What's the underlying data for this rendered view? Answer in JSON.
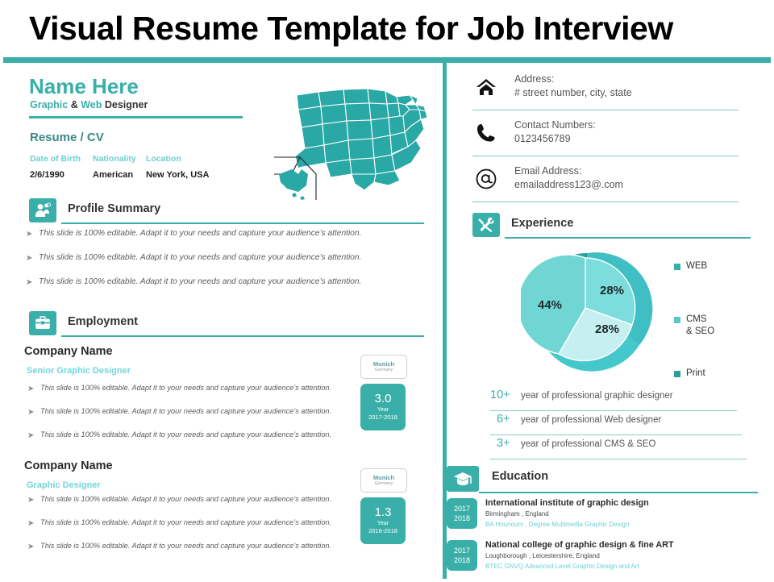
{
  "slide": {
    "title": "Visual Resume Template for Job Interview",
    "accent_color": "#3aafa9",
    "accent_light": "#6ccfcf",
    "accent_pale": "#c5eff0"
  },
  "profile": {
    "name": "Name Here",
    "subtitle_graphic": "Graphic",
    "subtitle_amp": " & ",
    "subtitle_web": "Web",
    "subtitle_designer": " Designer",
    "resume_label": "Resume / CV",
    "meta_headers": [
      "Date of Birth",
      "Nationality",
      "Location"
    ],
    "meta_values": [
      "2/6/1990",
      "American",
      "New York, USA"
    ],
    "map_icon": "usa-map"
  },
  "profile_summary": {
    "icon": "people-icon",
    "title": "Profile Summary",
    "bullets": [
      "This slide is 100% editable. Adapt it to your needs and capture your audience’s attention.",
      "This slide is 100% editable. Adapt it to your needs and capture your audience’s attention.",
      "This slide is 100% editable. Adapt it to your needs and capture your audience’s attention."
    ]
  },
  "employment": {
    "icon": "briefcase-icon",
    "title": "Employment",
    "jobs": [
      {
        "company": "Company Name",
        "role": "Senior Graphic Designer",
        "city": "Munich",
        "country": "Germany",
        "years": "3.0",
        "year_label": "Year",
        "year_range": "2017-2018",
        "bullets": [
          "This slide is 100% editable. Adapt it to your needs and capture your audience’s attention.",
          "This slide is 100% editable. Adapt it to your needs and capture your audience’s attention.",
          "This slide is 100% editable. Adapt it to your needs and capture your audience’s attention."
        ]
      },
      {
        "company": "Company Name",
        "role": "Graphic Designer",
        "city": "Munich",
        "country": "Germany",
        "years": "1.3",
        "year_label": "Year",
        "year_range": "2016-2018",
        "bullets": [
          "This slide is 100% editable. Adapt it to your needs and capture your audience’s attention.",
          "This slide is 100% editable. Adapt it to your needs and capture your audience’s attention.",
          "This slide is 100% editable. Adapt it to your needs and capture your audience’s attention."
        ]
      }
    ]
  },
  "contact": {
    "rows": [
      {
        "icon": "home-icon",
        "label": "Address:",
        "value": "# street number, city, state"
      },
      {
        "icon": "phone-icon",
        "label": "Contact Numbers:",
        "value": "0123456789"
      },
      {
        "icon": "at-icon",
        "label": "Email Address:",
        "value": "emailaddress123@.com"
      }
    ]
  },
  "experience": {
    "icon": "tools-icon",
    "title": "Experience",
    "bars": [
      {
        "num": "10+",
        "text": "year of professional  graphic  designer"
      },
      {
        "num": "6+",
        "text": "year of professional  Web designer"
      },
      {
        "num": "3+",
        "text": "year of professional  CMS & SEO"
      }
    ]
  },
  "chart_data": {
    "type": "pie",
    "title": "",
    "categories": [
      "WEB",
      "CMS & SEO",
      "Print"
    ],
    "values": [
      28,
      28,
      44
    ],
    "labels": [
      "28%",
      "28%",
      "44%"
    ],
    "colors": [
      "#7ddcdd",
      "#c5eff0",
      "#6fd6d4"
    ],
    "ring_colors": [
      "#3fbec4",
      "#45c8cc",
      "#2a9da2"
    ],
    "legend": [
      {
        "name": "WEB",
        "color": "#3aafa9"
      },
      {
        "name": "CMS\n& SEO",
        "color": "#57c9c4",
        "line1": "CMS",
        "line2": "& SEO"
      },
      {
        "name": "Print",
        "color": "#2e9e9a"
      }
    ],
    "legend_position": "right"
  },
  "education": {
    "icon": "graduation-cap-icon",
    "title": "Education",
    "items": [
      {
        "year_from": "2017",
        "year_to": "2018",
        "school": "International institute of graphic design",
        "place": "Birmingham , England",
        "degree": "BA Hounours , Degree Multimedia Graphic Design"
      },
      {
        "year_from": "2017",
        "year_to": "2018",
        "school": "National college of graphic design & fine ART",
        "place": "Loughborough , Leicestershire, England",
        "degree": "BTEC GNVQ Advanced Level Graphic Design and Art"
      }
    ]
  }
}
